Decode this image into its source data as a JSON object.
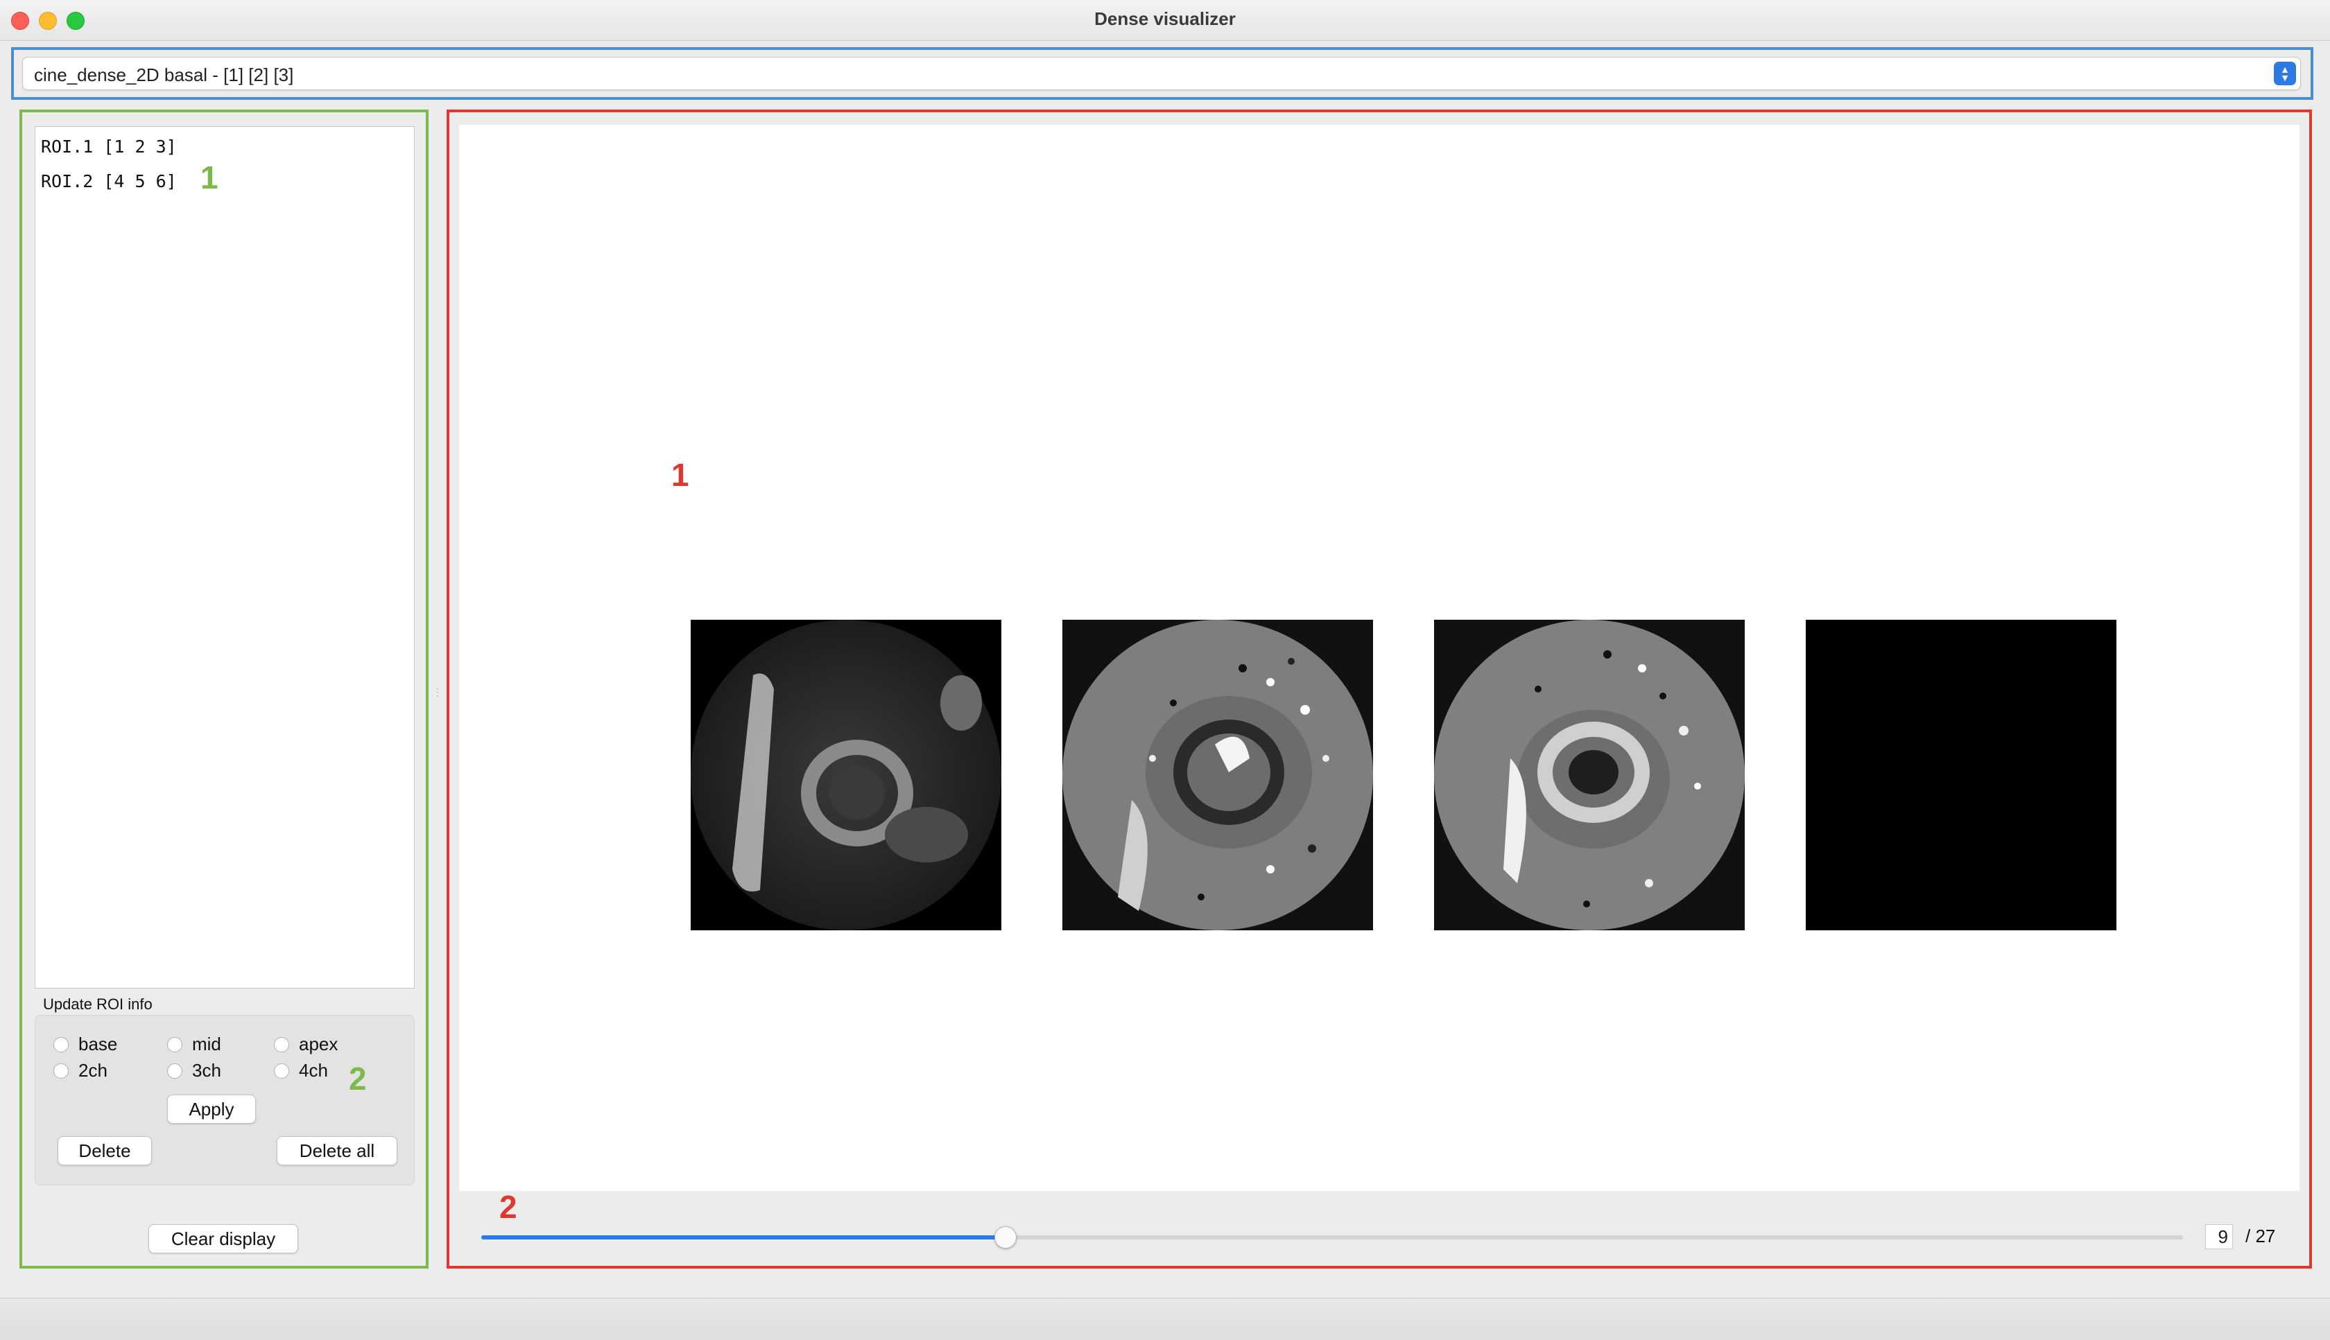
{
  "window": {
    "title": "Dense visualizer"
  },
  "dataset_selector": {
    "value": "cine_dense_2D basal - [1] [2] [3]"
  },
  "roi_list": {
    "items": [
      {
        "label": "ROI.1 [1 2 3]"
      },
      {
        "label": "ROI.2 [4 5 6]"
      }
    ]
  },
  "update_roi": {
    "title": "Update ROI info",
    "options": [
      "base",
      "mid",
      "apex",
      "2ch",
      "3ch",
      "4ch"
    ],
    "apply_label": "Apply",
    "delete_label": "Delete",
    "delete_all_label": "Delete all"
  },
  "clear_display_label": "Clear display",
  "annotations": {
    "left_list_marker": "1",
    "left_controls_marker": "2",
    "main_images_marker": "1",
    "main_slider_marker": "2"
  },
  "viewer": {
    "images": [
      {
        "name": "magnitude-image"
      },
      {
        "name": "phase-x-image"
      },
      {
        "name": "phase-y-image"
      },
      {
        "name": "empty-image"
      }
    ]
  },
  "frame_slider": {
    "current": "9",
    "total_label": "/ 27",
    "current_value": 9,
    "max_value": 27
  },
  "colors": {
    "selector_frame": "#4a90d0",
    "left_frame": "#7dba4c",
    "main_frame": "#e0382e",
    "accent": "#2a7be4"
  }
}
